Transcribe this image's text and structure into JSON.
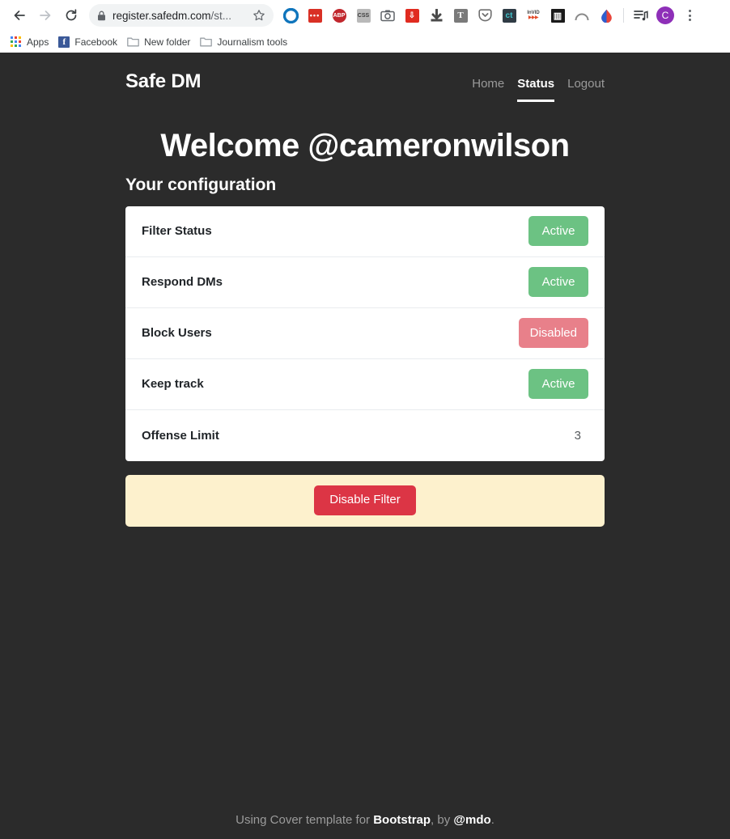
{
  "browser": {
    "back_icon": "back-arrow-icon",
    "forward_icon": "forward-arrow-icon",
    "reload_icon": "reload-icon",
    "lock_icon": "lock-icon",
    "url_domain": "register.safedm.com",
    "url_path": "/st...",
    "star_icon": "bookmark-star-icon",
    "profile_initial": "C",
    "menu_icon": "chrome-menu-icon",
    "extensions": [
      {
        "name": "grammarly-extension-icon",
        "glyph": "",
        "bg": "#ffffff",
        "fg": "#0f75bc"
      },
      {
        "name": "pocket-list-extension-icon",
        "glyph": "•••",
        "bg": "#d93025",
        "fg": "#ffffff"
      },
      {
        "name": "adblock-plus-extension-icon",
        "glyph": "ABP",
        "bg": "#c1272d",
        "fg": "#ffffff"
      },
      {
        "name": "css-viewer-extension-icon",
        "glyph": "CSS",
        "bg": "#b9b9b9",
        "fg": "#3c3c3c"
      },
      {
        "name": "screenshot-camera-extension-icon",
        "glyph": "◎",
        "bg": "#ffffff",
        "fg": "#5f6368"
      },
      {
        "name": "video-downloader-extension-icon",
        "glyph": "↓",
        "bg": "#e02b20",
        "fg": "#ffffff"
      },
      {
        "name": "download-arrow-extension-icon",
        "glyph": "⬇",
        "bg": "#4a4a4a",
        "fg": "#ffffff"
      },
      {
        "name": "text-tool-extension-icon",
        "glyph": "T",
        "bg": "#7a7a7a",
        "fg": "#ffffff"
      },
      {
        "name": "pocket-save-extension-icon",
        "glyph": "⌄",
        "bg": "#ffffff",
        "fg": "#6f6f6f"
      },
      {
        "name": "citation-tool-extension-icon",
        "glyph": "c",
        "bg": "#2f3b44",
        "fg": "#3fc1c9"
      },
      {
        "name": "invid-verification-extension-icon",
        "glyph": "InVID",
        "bg": "#ffffff",
        "fg": "#404040"
      },
      {
        "name": "archive-extension-icon",
        "glyph": "▥",
        "bg": "#1a1a1a",
        "fg": "#ffffff"
      },
      {
        "name": "arc-extension-icon",
        "glyph": "◠",
        "bg": "#ffffff",
        "fg": "#8a8a8a"
      },
      {
        "name": "colorpick-extension-icon",
        "glyph": "◆",
        "bg": "#e8443a",
        "fg": "#2d5fd0"
      },
      {
        "name": "playlist-extension-icon",
        "glyph": "☰",
        "bg": "#ffffff",
        "fg": "#3c4043"
      }
    ],
    "bookmarks": [
      {
        "label": "Apps",
        "icon": "apps-grid-icon"
      },
      {
        "label": "Facebook",
        "icon": "facebook-icon"
      },
      {
        "label": "New folder",
        "icon": "folder-icon"
      },
      {
        "label": "Journalism tools",
        "icon": "folder-icon"
      }
    ]
  },
  "site": {
    "brand": "Safe DM",
    "nav": [
      {
        "label": "Home",
        "active": false
      },
      {
        "label": "Status",
        "active": true
      },
      {
        "label": "Logout",
        "active": false
      }
    ],
    "welcome": "Welcome @cameronwilson",
    "subtitle": "Your configuration",
    "config_rows": [
      {
        "label": "Filter Status",
        "value": "Active",
        "kind": "badge",
        "color": "#6cc283"
      },
      {
        "label": "Respond DMs",
        "value": "Active",
        "kind": "badge",
        "color": "#6cc283"
      },
      {
        "label": "Block Users",
        "value": "Disabled",
        "kind": "badge",
        "color": "#e8808a"
      },
      {
        "label": "Keep track",
        "value": "Active",
        "kind": "badge",
        "color": "#6cc283"
      },
      {
        "label": "Offense Limit",
        "value": "3",
        "kind": "plain",
        "color": ""
      }
    ],
    "alert": {
      "button_label": "Disable Filter",
      "button_color": "#dc3545",
      "background": "#fdf1cd"
    },
    "footer": {
      "prefix": "Using Cover template for ",
      "bootstrap": "Bootstrap",
      "middle": ", by ",
      "mdo": "@mdo",
      "suffix": "."
    }
  }
}
